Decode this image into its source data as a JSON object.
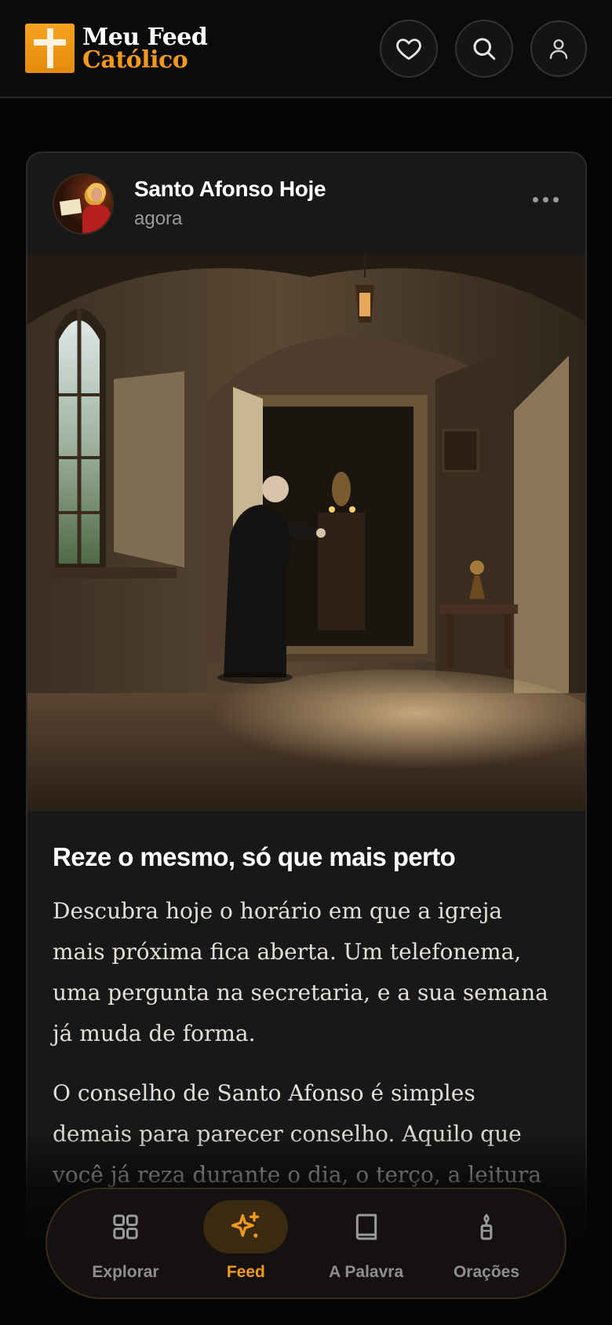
{
  "header": {
    "logo_line1": "Meu Feed",
    "logo_line2": "Católico",
    "brand_color": "#f39a1c",
    "icons": [
      "heart-icon",
      "search-icon",
      "user-icon"
    ]
  },
  "post": {
    "author": "Santo Afonso Hoje",
    "time": "agora",
    "title": "Reze o mesmo, só que mais perto",
    "paragraphs": [
      "Descubra hoje o horário em que a igreja mais próxima fica aberta. Um telefonema, uma pergunta na secretaria, e a sua semana já muda de forma.",
      "O conselho de Santo Afonso é simples demais para parecer conselho. Aquilo que você já reza durante o dia, o terço, a leitura"
    ]
  },
  "nav": {
    "items": [
      {
        "label": "Explorar",
        "icon": "grid-icon",
        "active": false
      },
      {
        "label": "Feed",
        "icon": "sparkles-icon",
        "active": true
      },
      {
        "label": "A Palavra",
        "icon": "book-icon",
        "active": false
      },
      {
        "label": "Orações",
        "icon": "candle-icon",
        "active": false
      }
    ]
  }
}
